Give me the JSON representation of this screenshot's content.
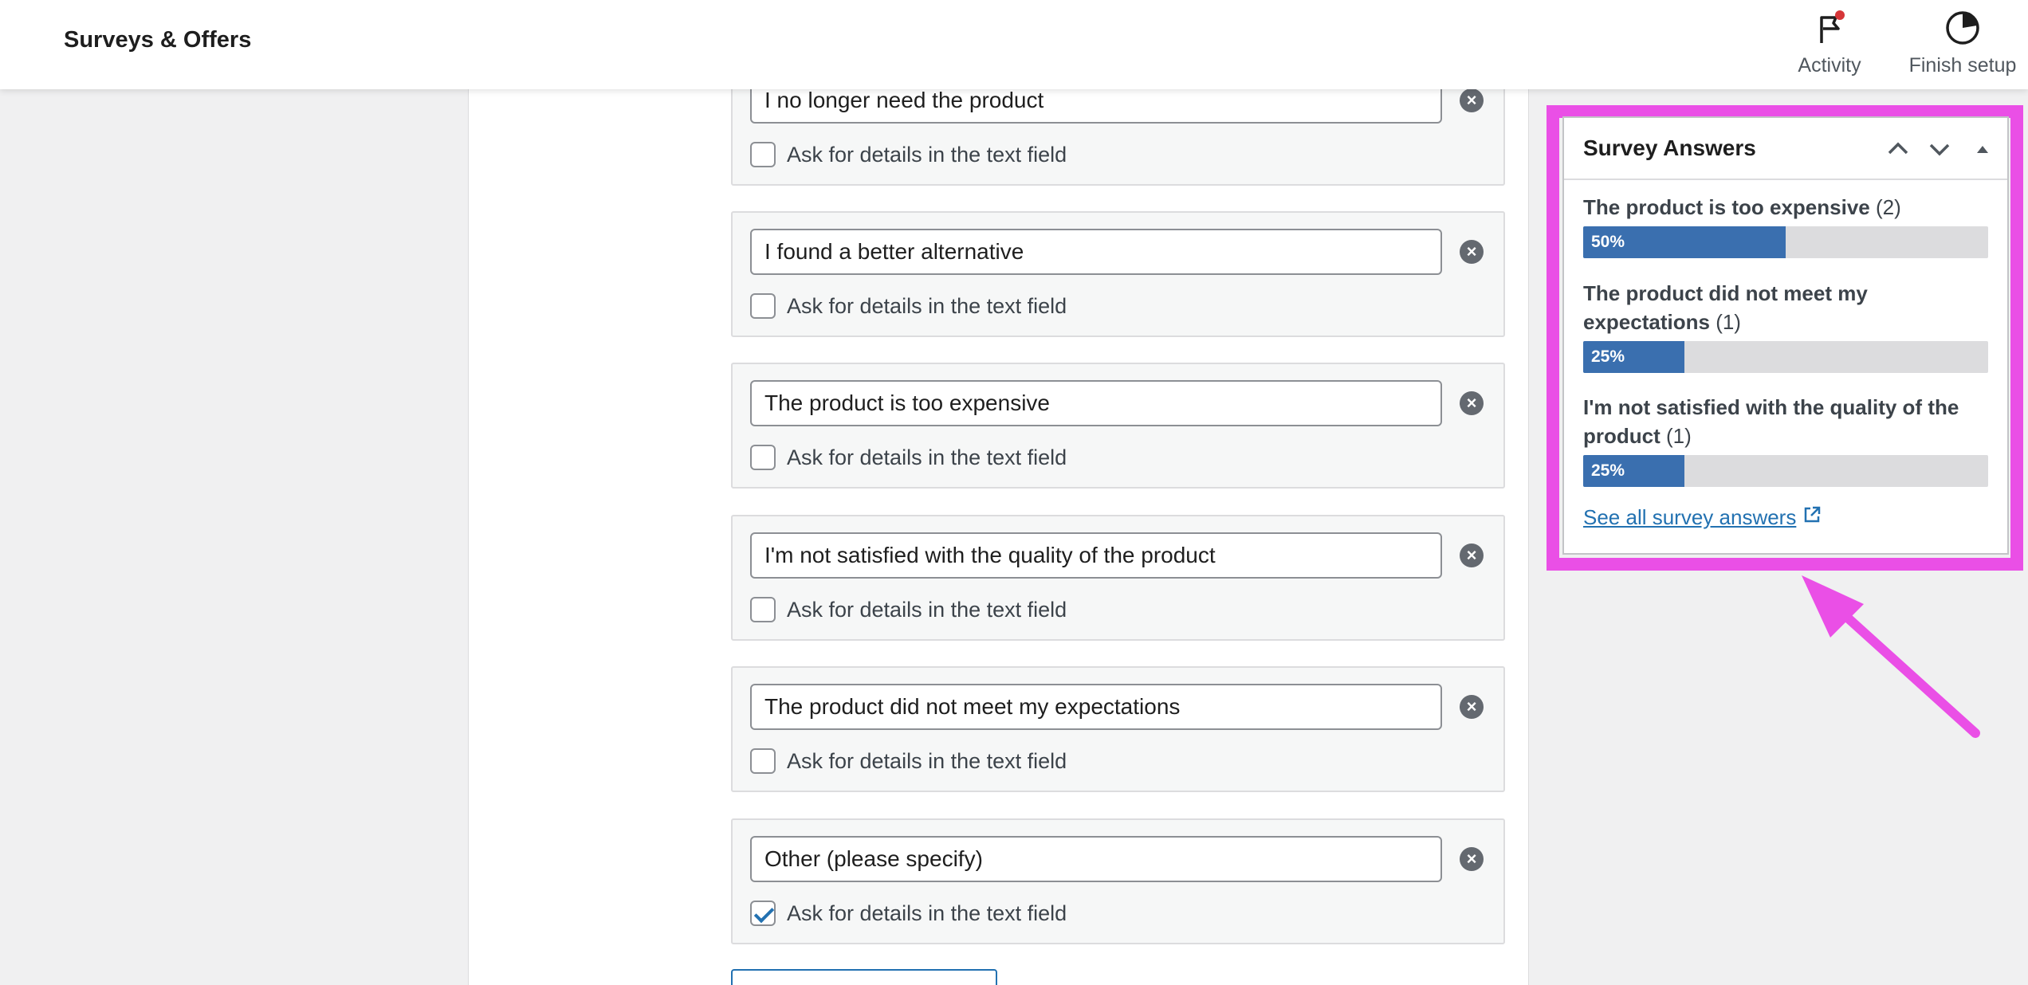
{
  "header": {
    "app_title": "Surveys & Offers",
    "actions": [
      {
        "label": "Activity",
        "icon": "flag-icon",
        "has_notification": true
      },
      {
        "label": "Finish setup",
        "icon": "progress-circle-icon"
      }
    ]
  },
  "answers": [
    {
      "value": "I no longer need the product",
      "detail_label": "Ask for details in the text field",
      "ask_details": false
    },
    {
      "value": "I found a better alternative",
      "detail_label": "Ask for details in the text field",
      "ask_details": false
    },
    {
      "value": "The product is too expensive",
      "detail_label": "Ask for details in the text field",
      "ask_details": false
    },
    {
      "value": "I'm not satisfied with the quality of the product",
      "detail_label": "Ask for details in the text field",
      "ask_details": false
    },
    {
      "value": "The product did not meet my expectations",
      "detail_label": "Ask for details in the text field",
      "ask_details": false
    },
    {
      "value": "Other (please specify)",
      "detail_label": "Ask for details in the text field",
      "ask_details": true
    }
  ],
  "widget": {
    "title": "Survey Answers",
    "results": [
      {
        "question": "The product is too expensive",
        "count": "(2)",
        "percent_label": "50%",
        "percent": 50
      },
      {
        "question": "The product did not meet my expectations",
        "count": "(1)",
        "percent_label": "25%",
        "percent": 25
      },
      {
        "question": "I'm not satisfied with the quality of the product",
        "count": "(1)",
        "percent_label": "25%",
        "percent": 25
      }
    ],
    "see_all_label": "See all survey answers"
  },
  "colors": {
    "highlight": "#ea4fe6",
    "bar_fill": "#3a6faf",
    "link": "#2271b1",
    "notification_dot": "#d63638"
  }
}
